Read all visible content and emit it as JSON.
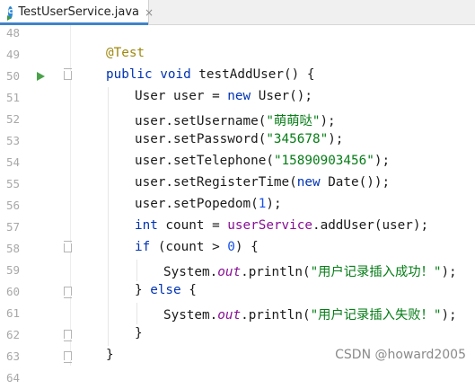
{
  "tab": {
    "label": "TestUserService.java",
    "close": "×",
    "icon": "java-class-icon",
    "icon_letter": "c"
  },
  "lines": [
    {
      "num": "48",
      "tokens": []
    },
    {
      "num": "49",
      "tokens": [
        {
          "t": "@Test",
          "c": "an"
        }
      ]
    },
    {
      "num": "50",
      "run": true,
      "fold": "open",
      "tokens": [
        {
          "t": "public",
          "c": "kw"
        },
        {
          "t": " "
        },
        {
          "t": "void",
          "c": "kw"
        },
        {
          "t": " testAddUser() {"
        }
      ]
    },
    {
      "num": "51",
      "tokens": [
        {
          "t": "User user = "
        },
        {
          "t": "new",
          "c": "kw"
        },
        {
          "t": " User();"
        }
      ]
    },
    {
      "num": "52",
      "tokens": [
        {
          "t": "user.setUsername("
        },
        {
          "t": "\"萌萌哒\"",
          "c": "str"
        },
        {
          "t": ");"
        }
      ]
    },
    {
      "num": "53",
      "tokens": [
        {
          "t": "user.setPassword("
        },
        {
          "t": "\"345678\"",
          "c": "str"
        },
        {
          "t": ");"
        }
      ]
    },
    {
      "num": "54",
      "tokens": [
        {
          "t": "user.setTelephone("
        },
        {
          "t": "\"15890903456\"",
          "c": "str"
        },
        {
          "t": ");"
        }
      ]
    },
    {
      "num": "55",
      "tokens": [
        {
          "t": "user.setRegisterTime("
        },
        {
          "t": "new",
          "c": "kw"
        },
        {
          "t": " Date());"
        }
      ]
    },
    {
      "num": "56",
      "tokens": [
        {
          "t": "user.setPopedom("
        },
        {
          "t": "1",
          "c": "num"
        },
        {
          "t": ");"
        }
      ]
    },
    {
      "num": "57",
      "tokens": [
        {
          "t": "int",
          "c": "kw"
        },
        {
          "t": " count = "
        },
        {
          "t": "userService",
          "c": "fld"
        },
        {
          "t": ".addUser(user);"
        }
      ]
    },
    {
      "num": "58",
      "fold": "open",
      "tokens": [
        {
          "t": "if",
          "c": "kw"
        },
        {
          "t": " (count > "
        },
        {
          "t": "0",
          "c": "num"
        },
        {
          "t": ") {"
        }
      ]
    },
    {
      "num": "59",
      "tokens": [
        {
          "t": "System."
        },
        {
          "t": "out",
          "c": "st"
        },
        {
          "t": ".println("
        },
        {
          "t": "\"用户记录插入成功！\"",
          "c": "str"
        },
        {
          "t": ");"
        }
      ]
    },
    {
      "num": "60",
      "fold": "close",
      "tokens": [
        {
          "t": "} "
        },
        {
          "t": "else",
          "c": "kw"
        },
        {
          "t": " {"
        }
      ]
    },
    {
      "num": "61",
      "tokens": [
        {
          "t": "System."
        },
        {
          "t": "out",
          "c": "st"
        },
        {
          "t": ".println("
        },
        {
          "t": "\"用户记录插入失败！\"",
          "c": "str"
        },
        {
          "t": ");"
        }
      ]
    },
    {
      "num": "62",
      "fold": "close",
      "tokens": [
        {
          "t": "}"
        }
      ]
    },
    {
      "num": "63",
      "fold": "close",
      "tokens": [
        {
          "t": "}"
        }
      ]
    },
    {
      "num": "64",
      "tokens": []
    }
  ],
  "watermark": "CSDN @howard2005"
}
